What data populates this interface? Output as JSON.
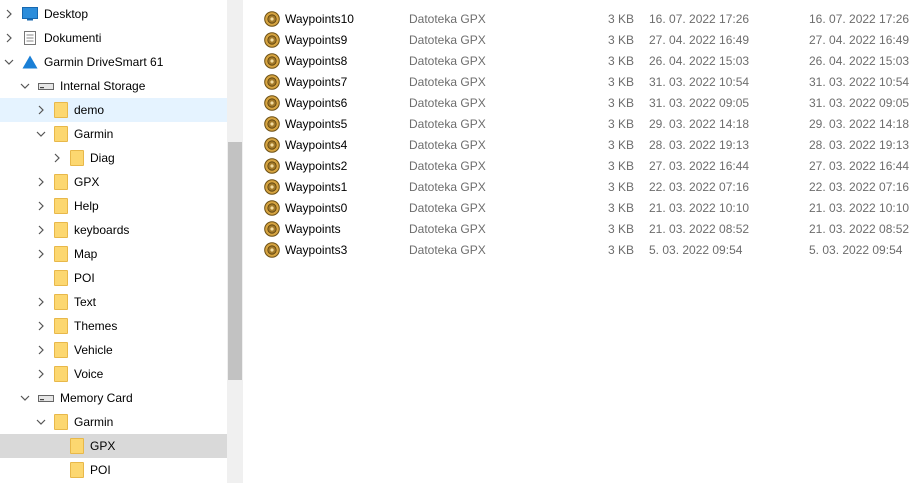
{
  "nav": {
    "items": [
      {
        "label": "Desktop",
        "icon": "desktop-icon",
        "chevron": "right",
        "indent": 0
      },
      {
        "label": "Dokumenti",
        "icon": "documents-icon",
        "chevron": "right",
        "indent": 0
      },
      {
        "label": "Garmin DriveSmart 61",
        "icon": "garmin-device-icon",
        "chevron": "down",
        "indent": 0
      },
      {
        "label": "Internal Storage",
        "icon": "drive-icon",
        "chevron": "down",
        "indent": 1
      },
      {
        "label": "demo",
        "icon": "folder-icon",
        "chevron": "right",
        "indent": 2,
        "state": "hover"
      },
      {
        "label": "Garmin",
        "icon": "folder-icon",
        "chevron": "down",
        "indent": 2
      },
      {
        "label": "Diag",
        "icon": "folder-icon",
        "chevron": "right",
        "indent": 3
      },
      {
        "label": "GPX",
        "icon": "folder-icon",
        "chevron": "right",
        "indent": 2
      },
      {
        "label": "Help",
        "icon": "folder-icon",
        "chevron": "right",
        "indent": 2
      },
      {
        "label": "keyboards",
        "icon": "folder-icon",
        "chevron": "right",
        "indent": 2
      },
      {
        "label": "Map",
        "icon": "folder-icon",
        "chevron": "right",
        "indent": 2
      },
      {
        "label": "POI",
        "icon": "folder-icon",
        "chevron": "none",
        "indent": 2
      },
      {
        "label": "Text",
        "icon": "folder-icon",
        "chevron": "right",
        "indent": 2
      },
      {
        "label": "Themes",
        "icon": "folder-icon",
        "chevron": "right",
        "indent": 2
      },
      {
        "label": "Vehicle",
        "icon": "folder-icon",
        "chevron": "right",
        "indent": 2
      },
      {
        "label": "Voice",
        "icon": "folder-icon",
        "chevron": "right",
        "indent": 2
      },
      {
        "label": "Memory Card",
        "icon": "drive-icon",
        "chevron": "down",
        "indent": 1
      },
      {
        "label": "Garmin",
        "icon": "folder-icon",
        "chevron": "down",
        "indent": 2
      },
      {
        "label": "GPX",
        "icon": "folder-icon",
        "chevron": "none",
        "indent": 3,
        "state": "selected"
      },
      {
        "label": "POI",
        "icon": "folder-icon",
        "chevron": "none",
        "indent": 3
      }
    ]
  },
  "files": [
    {
      "name": "Waypoints10",
      "type": "Datoteka GPX",
      "size": "3 KB",
      "modified": "16. 07. 2022 17:26",
      "created": "16. 07. 2022 17:26"
    },
    {
      "name": "Waypoints9",
      "type": "Datoteka GPX",
      "size": "3 KB",
      "modified": "27. 04. 2022 16:49",
      "created": "27. 04. 2022 16:49"
    },
    {
      "name": "Waypoints8",
      "type": "Datoteka GPX",
      "size": "3 KB",
      "modified": "26. 04. 2022 15:03",
      "created": "26. 04. 2022 15:03"
    },
    {
      "name": "Waypoints7",
      "type": "Datoteka GPX",
      "size": "3 KB",
      "modified": "31. 03. 2022 10:54",
      "created": "31. 03. 2022 10:54"
    },
    {
      "name": "Waypoints6",
      "type": "Datoteka GPX",
      "size": "3 KB",
      "modified": "31. 03. 2022 09:05",
      "created": "31. 03. 2022 09:05"
    },
    {
      "name": "Waypoints5",
      "type": "Datoteka GPX",
      "size": "3 KB",
      "modified": "29. 03. 2022 14:18",
      "created": "29. 03. 2022 14:18"
    },
    {
      "name": "Waypoints4",
      "type": "Datoteka GPX",
      "size": "3 KB",
      "modified": "28. 03. 2022 19:13",
      "created": "28. 03. 2022 19:13"
    },
    {
      "name": "Waypoints2",
      "type": "Datoteka GPX",
      "size": "3 KB",
      "modified": "27. 03. 2022 16:44",
      "created": "27. 03. 2022 16:44"
    },
    {
      "name": "Waypoints1",
      "type": "Datoteka GPX",
      "size": "3 KB",
      "modified": "22. 03. 2022 07:16",
      "created": "22. 03. 2022 07:16"
    },
    {
      "name": "Waypoints0",
      "type": "Datoteka GPX",
      "size": "3 KB",
      "modified": "21. 03. 2022 10:10",
      "created": "21. 03. 2022 10:10"
    },
    {
      "name": "Waypoints",
      "type": "Datoteka GPX",
      "size": "3 KB",
      "modified": "21. 03. 2022 08:52",
      "created": "21. 03. 2022 08:52"
    },
    {
      "name": "Waypoints3",
      "type": "Datoteka GPX",
      "size": "3 KB",
      "modified": "5. 03. 2022 09:54",
      "created": "5. 03. 2022 09:54"
    }
  ],
  "colors": {
    "hover": "#e5f3ff",
    "selected": "#d9d9d9",
    "folder": "#fcd770",
    "garmin": "#1a7fd6"
  }
}
